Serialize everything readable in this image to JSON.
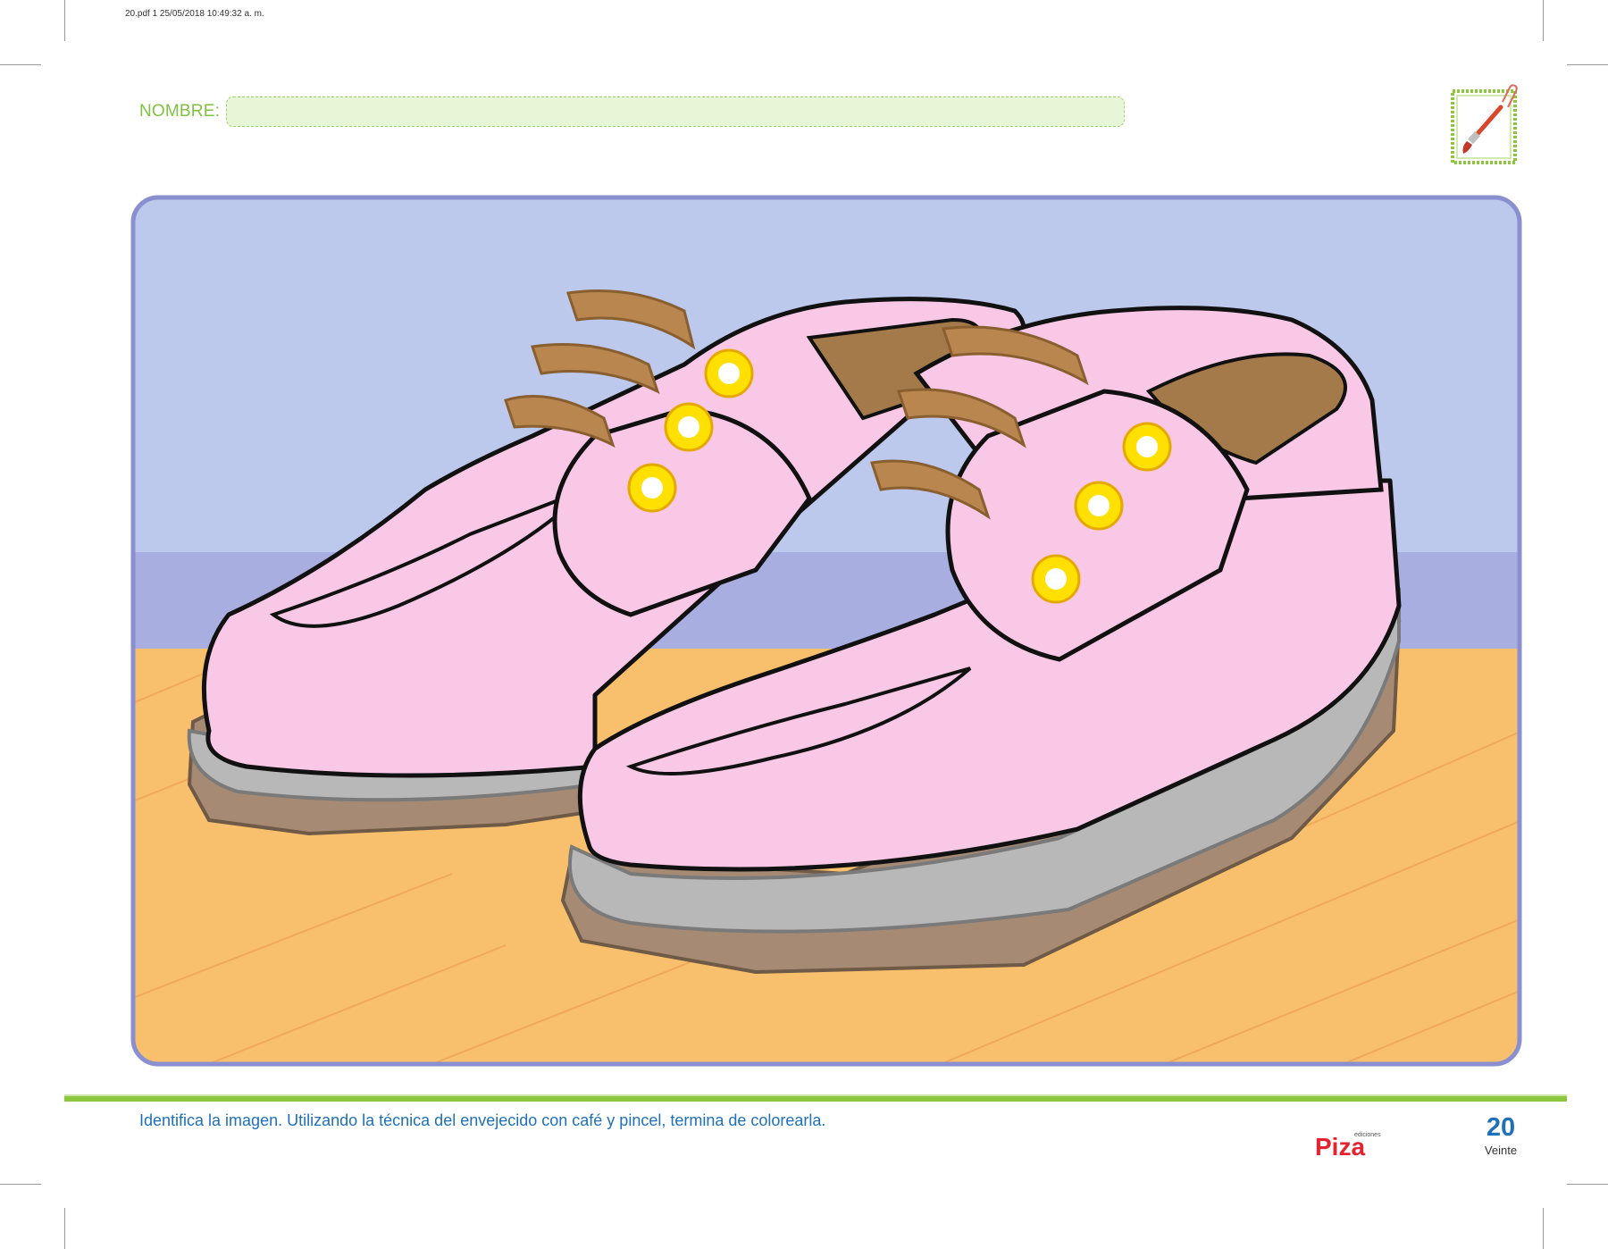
{
  "print_info": "20.pdf   1   25/05/2018   10:49:32 a. m.",
  "header": {
    "name_label": "NOMBRE:",
    "name_value": ""
  },
  "instruction": "Identifica la imagen. Utilizando la técnica del envejecido con café y pincel, termina de colorearla.",
  "footer": {
    "publisher_top": "ediciones",
    "publisher_name": "Piza",
    "page_number": "20",
    "page_word": "Veinte"
  },
  "icons": {
    "activity": "paintbrush-icon",
    "clip": "paperclip-icon"
  },
  "colors": {
    "accent_green": "#8cc63f",
    "text_blue": "#1e70b8",
    "shoe_pink": "#f8c8e6",
    "lace_brown": "#b8864e",
    "sole_brown": "#a68a73",
    "welt_gray": "#b8b8b8",
    "sky": "#bcc8ec",
    "floor": "#f8c06c",
    "logo_red": "#e52330"
  }
}
